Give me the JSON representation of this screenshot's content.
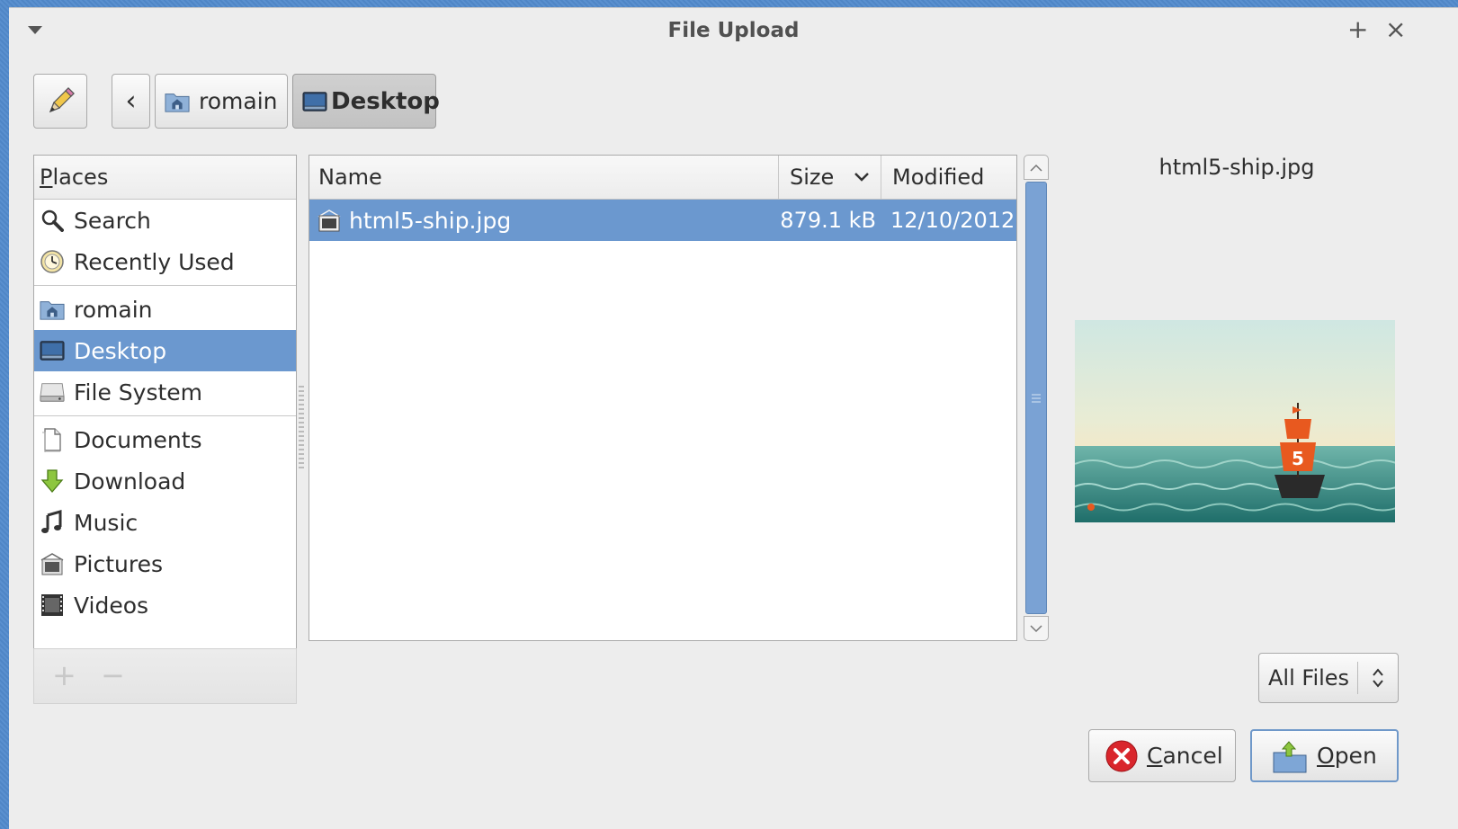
{
  "window": {
    "title": "File Upload",
    "maximize_icon": "+",
    "close_icon": "×"
  },
  "pathbar": {
    "back_icon": "‹",
    "crumbs": [
      {
        "label": "romain",
        "icon": "home-folder-icon"
      },
      {
        "label": "Desktop",
        "icon": "desktop-icon",
        "active": true
      }
    ]
  },
  "places": {
    "header_accel": "P",
    "header_rest": "laces",
    "groups": [
      [
        {
          "label": "Search",
          "icon": "search-icon"
        },
        {
          "label": "Recently Used",
          "icon": "clock-icon"
        }
      ],
      [
        {
          "label": "romain",
          "icon": "home-folder-icon"
        },
        {
          "label": "Desktop",
          "icon": "desktop-icon",
          "selected": true
        },
        {
          "label": "File System",
          "icon": "drive-icon"
        }
      ],
      [
        {
          "label": "Documents",
          "icon": "document-icon"
        },
        {
          "label": "Download",
          "icon": "download-icon"
        },
        {
          "label": "Music",
          "icon": "music-icon"
        },
        {
          "label": "Pictures",
          "icon": "pictures-icon"
        },
        {
          "label": "Videos",
          "icon": "video-icon"
        }
      ]
    ],
    "add_label": "+",
    "remove_label": "−"
  },
  "files": {
    "columns": {
      "name": "Name",
      "size": "Size",
      "modified": "Modified"
    },
    "rows": [
      {
        "name": "html5-ship.jpg",
        "size": "879.1 kB",
        "modified": "12/10/2012",
        "selected": true
      }
    ]
  },
  "preview": {
    "filename": "html5-ship.jpg",
    "badge": "5"
  },
  "filter": {
    "selected": "All Files"
  },
  "actions": {
    "cancel_accel": "C",
    "cancel_rest": "ancel",
    "open_accel": "O",
    "open_rest": "pen"
  },
  "colors": {
    "selection": "#6b98cf",
    "accent": "#4a90d9",
    "ship_sail": "#e8591f"
  }
}
